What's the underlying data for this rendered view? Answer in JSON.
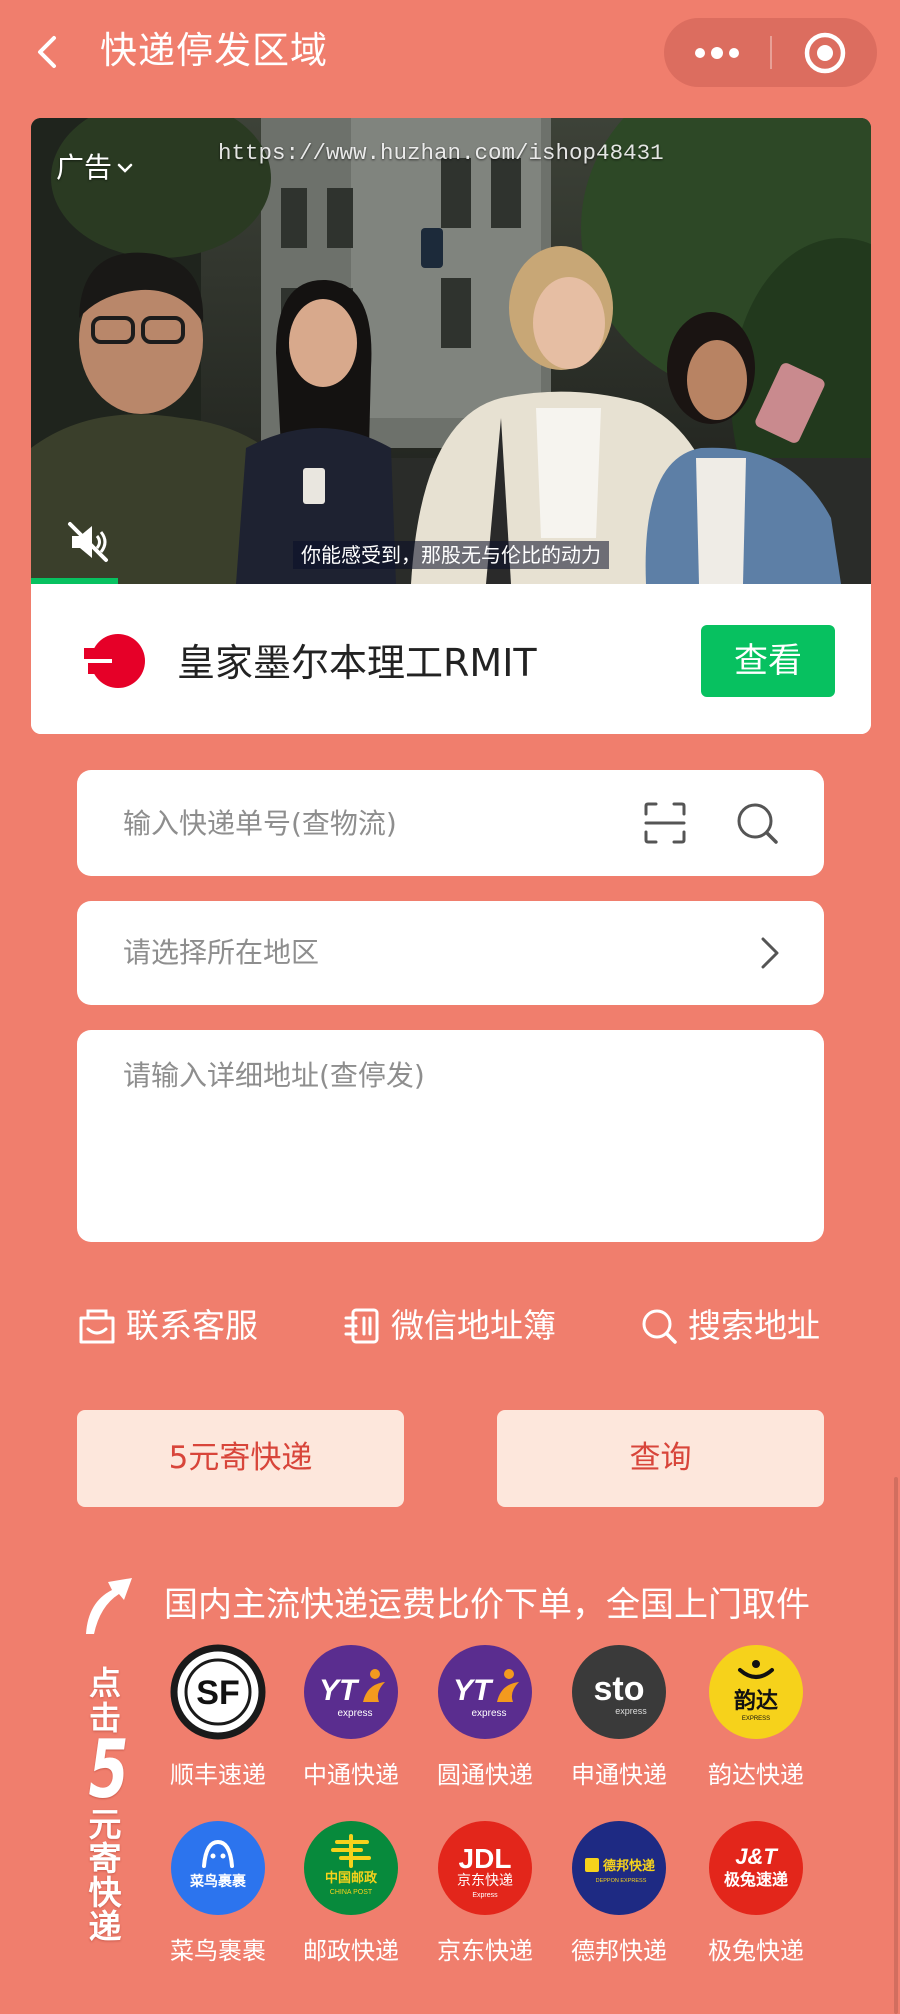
{
  "header": {
    "title": "快递停发区域",
    "back_icon": "chevron-left-icon",
    "more_icon": "more-dots-icon",
    "capsule_close_icon": "target-circle-icon"
  },
  "ad": {
    "badge": "广告",
    "watermark": "https://www.huzhan.com/ishop48431",
    "subtitle": "你能感受到，那股无与伦比的动力",
    "advertiser": "皇家墨尔本理工RMIT",
    "cta_label": "查看",
    "video_progress": 0.104,
    "mute_icon": "muted-speaker-icon",
    "logo_icon": "rmit-logo-icon"
  },
  "form": {
    "tracking": {
      "placeholder": "输入快递单号(查物流)",
      "scan_icon": "scan-icon",
      "search_icon": "search-icon"
    },
    "region": {
      "placeholder": "请选择所在地区",
      "icon": "chevron-right-icon"
    },
    "address": {
      "placeholder": "请输入详细地址(查停发)"
    }
  },
  "links": [
    {
      "label": "联系客服",
      "icon": "customer-service-icon"
    },
    {
      "label": "微信地址簿",
      "icon": "address-book-icon"
    },
    {
      "label": "搜索地址",
      "icon": "search-icon"
    }
  ],
  "actions": {
    "send_label": "5元寄快递",
    "query_label": "查询"
  },
  "promo": {
    "headline": "国内主流快递运费比价下单，全国上门取件",
    "arrow_icon": "curved-arrow-icon",
    "side_top": "点击",
    "side_number": "5",
    "side_bottom": "元寄快递"
  },
  "couriers": [
    {
      "name": "顺丰速递",
      "color": "#FFFFFF",
      "logo_text": "SF"
    },
    {
      "name": "中通快递",
      "color": "#5A2D8F",
      "logo_text": "YT",
      "logo_sub": "express"
    },
    {
      "name": "圆通快递",
      "color": "#5A2D8F",
      "logo_text": "YT",
      "logo_sub": "express"
    },
    {
      "name": "申通快递",
      "color": "#3A3A3A",
      "logo_text": "sto",
      "logo_sub": "express"
    },
    {
      "name": "韵达快递",
      "color": "#F6D21B",
      "logo_text": "韵达",
      "logo_sub": "EXPRESS"
    },
    {
      "name": "菜鸟裹裹",
      "color": "#2C74EE",
      "logo_text": "菜鸟裹裹"
    },
    {
      "name": "邮政快递",
      "color": "#078A3C",
      "logo_text": "中国邮政",
      "logo_sub": "CHINA POST"
    },
    {
      "name": "京东快递",
      "color": "#E3261B",
      "logo_text": "JDL",
      "logo_sub": "京东快递",
      "logo_sub2": "Express"
    },
    {
      "name": "德邦快递",
      "color": "#1E2A83",
      "logo_text": "德邦快递",
      "logo_sub": "DEPPON EXPRESS"
    },
    {
      "name": "极兔快递",
      "color": "#E3261B",
      "logo_text": "J&T",
      "logo_sub": "极兔速递"
    }
  ],
  "colors": {
    "page_bg": "#F07E6D",
    "cta_green": "#07C160",
    "button_bg": "#FDE7DC",
    "button_text": "#D8453A"
  }
}
